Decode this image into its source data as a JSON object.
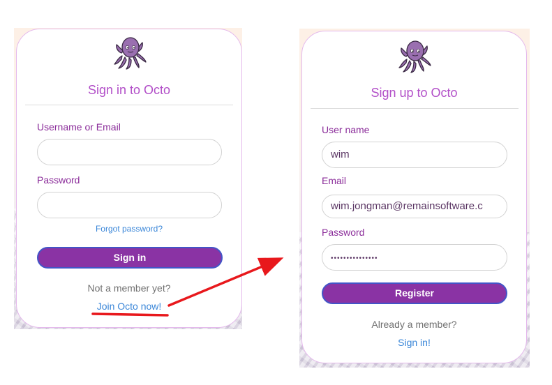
{
  "signin": {
    "title": "Sign in to Octo",
    "username_label": "Username or Email",
    "username_value": "",
    "password_label": "Password",
    "password_value": "",
    "forgot_link": "Forgot password?",
    "submit_label": "Sign in",
    "not_member_text": "Not a member yet?",
    "join_link": "Join Octo now!"
  },
  "signup": {
    "title": "Sign up to Octo",
    "username_label": "User name",
    "username_value": "wim",
    "email_label": "Email",
    "email_value": "wim.jongman@remainsoftware.c",
    "password_label": "Password",
    "password_masked": "•••••••••••••••",
    "submit_label": "Register",
    "already_member_text": "Already a member?",
    "signin_link": "Sign in!"
  },
  "annotations": {
    "arrow_color": "#e8181c",
    "underline_color": "#e8181c"
  },
  "colors": {
    "accent": "#8a33a4",
    "title": "#b24fc8",
    "label": "#8b2d9a",
    "link": "#3a86d8"
  },
  "icons": {
    "logo": "octopus-icon"
  }
}
